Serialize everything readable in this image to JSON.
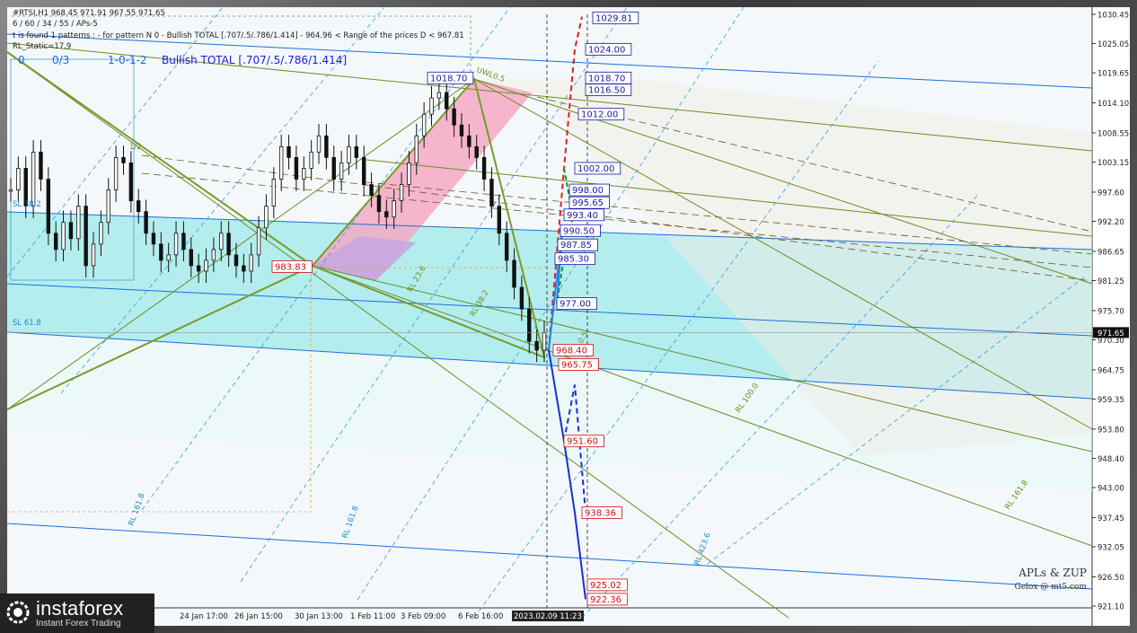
{
  "header": {
    "line1": "#RTSI,H1  968.45 971.91 967.55 971.65",
    "line2": "6 / 60 / 34 / 55 / APs-5",
    "line3": "t is found 1 patterns :  - for pattern N 0 - Bullish TOTAL [.707/.5/.786/1.414] - 964.96 < Range of the prices D < 967.81",
    "line4": "RL_Static=17.9",
    "pattern_row": [
      "0",
      "0/3",
      "1-0-1-2",
      "Bullish TOTAL [.707/.5/.786/1.414]"
    ]
  },
  "colors": {
    "background": "#f4f8fb",
    "cyan_channel": "#7fe3e3",
    "pink_channel": "#f4a9c4",
    "purple_zone": "#c5a6e0",
    "olive": "#6b8e23",
    "blue_label": "#1a1aa0",
    "red_label": "#cc1111"
  },
  "chart_data": {
    "type": "candlestick",
    "symbol": "#RTSI",
    "timeframe": "H1",
    "ylim": [
      921.1,
      1030.45
    ],
    "y_ticks": [
      "1030.45",
      "1025.05",
      "1019.65",
      "1014.10",
      "1008.55",
      "1003.15",
      "997.60",
      "992.20",
      "986.65",
      "981.25",
      "975.70",
      "970.30",
      "964.75",
      "959.35",
      "953.80",
      "948.40",
      "943.00",
      "937.45",
      "932.05",
      "926.50",
      "921.10"
    ],
    "x_ticks": [
      "24 Jan 17:00",
      "26 Jan 15:00",
      "30 Jan 13:00",
      "1 Feb 11:00",
      "3 Feb 09:00",
      "6 Feb 16:00",
      "2023.02.09 11:23"
    ],
    "current_price": "971.65",
    "pivots": [
      {
        "label": "983.83",
        "value": 983.83,
        "color": "red"
      },
      {
        "label": "1018.70",
        "value": 1018.7,
        "color": "blue"
      },
      {
        "label": "968.40",
        "value": 968.4,
        "color": "red"
      }
    ],
    "upper_targets": [
      {
        "label": "1029.81",
        "value": 1029.81
      },
      {
        "label": "1024.00",
        "value": 1024.0
      },
      {
        "label": "1018.70",
        "value": 1018.7
      },
      {
        "label": "1016.50",
        "value": 1016.5
      },
      {
        "label": "1012.00",
        "value": 1012.0
      },
      {
        "label": "1002.00",
        "value": 1002.0
      },
      {
        "label": "998.00",
        "value": 998.0
      },
      {
        "label": "995.65",
        "value": 995.65
      },
      {
        "label": "993.40",
        "value": 993.4
      },
      {
        "label": "990.50",
        "value": 990.5
      },
      {
        "label": "987.85",
        "value": 987.85
      },
      {
        "label": "985.30",
        "value": 985.3
      },
      {
        "label": "977.00",
        "value": 977.0
      }
    ],
    "lower_targets": [
      {
        "label": "965.75",
        "value": 965.75
      },
      {
        "label": "951.60",
        "value": 951.6
      },
      {
        "label": "938.36",
        "value": 938.36
      },
      {
        "label": "925.02",
        "value": 925.02
      },
      {
        "label": "922.36",
        "value": 922.36
      }
    ],
    "annotations": [
      "SL 38.2",
      "SL 61.8",
      "UWL0.5",
      "1/2",
      "RL 23.6",
      "RL 38.2",
      "RL 100.0",
      "RL 161.8",
      "RL 161.8",
      "RL 161.8",
      "RL 423.6",
      "0.5"
    ]
  },
  "credit": {
    "line1": "APLs & ZUP",
    "line2": "Gelox @ mt5.com"
  },
  "logo": {
    "name": "instaforex",
    "tagline": "Instant Forex Trading"
  }
}
